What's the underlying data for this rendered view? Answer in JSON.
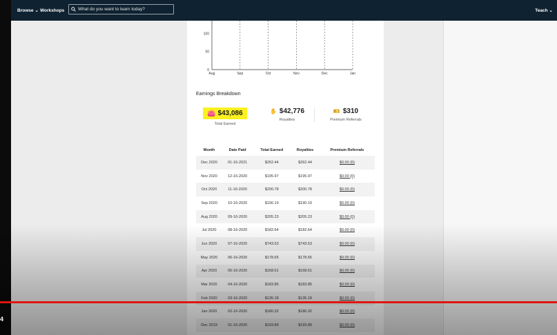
{
  "nav": {
    "browse": "Browse",
    "workshops": "Workshops",
    "teach": "Teach",
    "search_placeholder": "What do you want to learn today?"
  },
  "chart_data": {
    "type": "bar",
    "categories": [
      "Aug",
      "Sep",
      "Oct",
      "Nov",
      "Dec",
      "Jan"
    ],
    "yticks": [
      0,
      50,
      100
    ],
    "values": [],
    "grid": "vertical dashed"
  },
  "breakdown": {
    "title": "Earnings Breakdown",
    "total_earned": {
      "value": "$43,086",
      "label": "Total Earned",
      "icon": "wallet-icon"
    },
    "royalties": {
      "value": "$42,776",
      "label": "Royalties",
      "icon": "hand-coin-icon"
    },
    "premium_referrals": {
      "value": "$310",
      "label": "Premium Referrals",
      "icon": "ticket-icon"
    },
    "highlight_color": "#fbf11f"
  },
  "table": {
    "headers": [
      "Month",
      "Date Paid",
      "Total Earned",
      "Royalties",
      "Premium Referrals"
    ],
    "rows": [
      [
        "Dec 2020",
        "01-16-2021",
        "$262.44",
        "$262.44",
        "$0.00 (0)"
      ],
      [
        "Nov 2020",
        "12-16-2020",
        "$195.97",
        "$195.97",
        "$0.00 (0)"
      ],
      [
        "Oct 2020",
        "11-16-2020",
        "$200.78",
        "$200.78",
        "$0.00 (0)"
      ],
      [
        "Sep 2020",
        "10-16-2020",
        "$190.19",
        "$190.19",
        "$0.00 (0)"
      ],
      [
        "Aug 2020",
        "09-16-2020",
        "$205.23",
        "$205.23",
        "$0.00 (0)"
      ],
      [
        "Jul 2020",
        "08-16-2020",
        "$182.64",
        "$182.64",
        "$0.00 (0)"
      ],
      [
        "Jun 2020",
        "07-16-2020",
        "$743.53",
        "$743.53",
        "$0.00 (0)"
      ],
      [
        "May 2020",
        "06-16-2020",
        "$178.65",
        "$178.65",
        "$0.00 (0)"
      ],
      [
        "Apr 2020",
        "05-16-2020",
        "$168.61",
        "$168.61",
        "$0.00 (0)"
      ],
      [
        "Mar 2020",
        "04-16-2020",
        "$183.85",
        "$183.85",
        "$0.00 (0)"
      ],
      [
        "Feb 2020",
        "03-16-2020",
        "$135.18",
        "$135.18",
        "$0.00 (0)"
      ],
      [
        "Jan 2020",
        "02-16-2020",
        "$180.32",
        "$180.32",
        "$0.00 (0)"
      ],
      [
        "Dec 2019",
        "01-16-2020",
        "$193.89",
        "$193.89",
        "$0.00 (0)"
      ]
    ]
  },
  "video": {
    "timestamp": "4",
    "progress_color": "#e0140e"
  }
}
